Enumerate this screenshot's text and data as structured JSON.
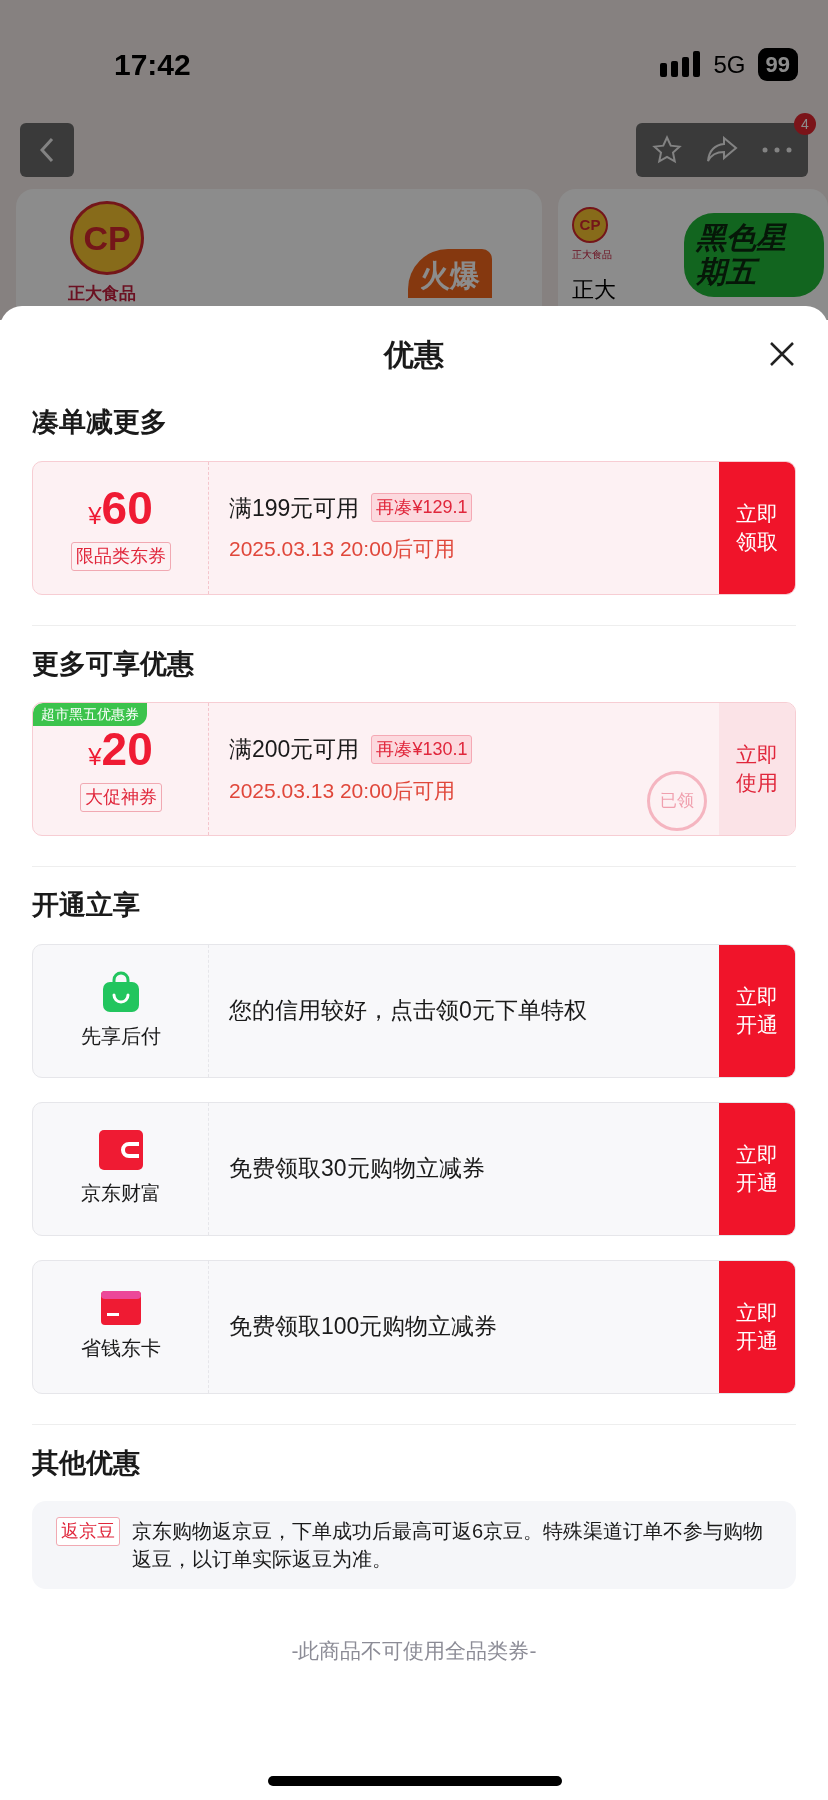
{
  "status_bar": {
    "time": "17:42",
    "network": "5G",
    "battery": "99"
  },
  "nav": {
    "badge": "4"
  },
  "background_cards": [
    {
      "logo": "CP",
      "brand": "正大食品",
      "tag": "火爆"
    },
    {
      "logo": "CP",
      "brand": "正大食品",
      "title": "正大",
      "promo": "黑色星期五"
    }
  ],
  "sheet": {
    "title": "优惠"
  },
  "sections": [
    {
      "title": "凑单减更多",
      "items": [
        {
          "kind": "coupon",
          "currency": "¥",
          "amount": "60",
          "label": "限品类东券",
          "condition": "满199元可用",
          "gap": "再凑¥129.1",
          "time": "2025.03.13 20:00后可用",
          "action": "立即领取",
          "claimed": false
        }
      ]
    },
    {
      "title": "更多可享优惠",
      "items": [
        {
          "kind": "coupon",
          "ribbon": "超市黑五优惠券",
          "currency": "¥",
          "amount": "20",
          "label": "大促神券",
          "condition": "满200元可用",
          "gap": "再凑¥130.1",
          "time": "2025.03.13 20:00后可用",
          "action": "立即使用",
          "claimed": true,
          "stamp": "已领"
        }
      ]
    },
    {
      "title": "开通立享",
      "items": [
        {
          "kind": "service",
          "name": "先享后付",
          "text": "您的信用较好，点击领0元下单特权",
          "action": "立即开通"
        },
        {
          "kind": "service",
          "name": "京东财富",
          "text": "免费领取30元购物立减券",
          "action": "立即开通"
        },
        {
          "kind": "service",
          "name": "省钱东卡",
          "text": "免费领取100元购物立减券",
          "action": "立即开通"
        }
      ]
    },
    {
      "title": "其他优惠",
      "items": [
        {
          "kind": "info",
          "tag": "返京豆",
          "text": "京东购物返京豆，下单成功后最高可返6京豆。特殊渠道订单不参与购物返豆，以订单实际返豆为准。"
        }
      ]
    }
  ],
  "footer": "-此商品不可使用全品类券-"
}
